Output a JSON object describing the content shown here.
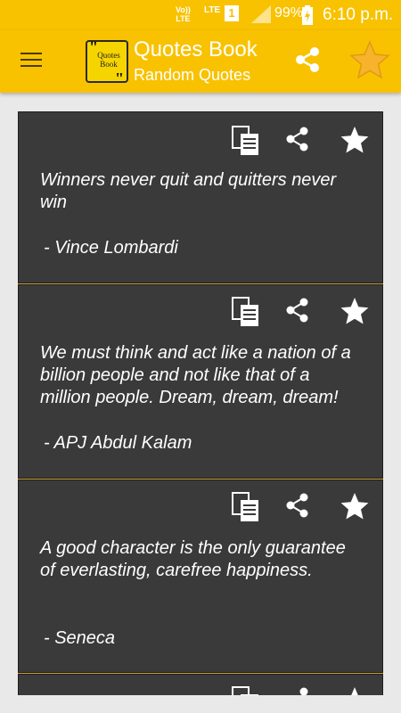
{
  "status_bar": {
    "volte": "Vo))\nLTE",
    "lte": "LTE",
    "sim": "1",
    "battery": "99%",
    "time": "6:10 p.m."
  },
  "app_bar": {
    "logo_text": "Quotes Book",
    "title": "Quotes Book",
    "subtitle": "Random Quotes"
  },
  "colors": {
    "accent": "#f8c200",
    "card_bg": "#3a3a3a",
    "separator": "#c8a23a"
  },
  "quotes": [
    {
      "text": "Winners never quit and quitters never win",
      "author": "- Vince Lombardi"
    },
    {
      "text": "We must think and act like a nation of a billion people and not like that of a million people. Dream, dream, dream!",
      "author": "- APJ Abdul Kalam"
    },
    {
      "text": "A good character is the only guarantee of everlasting, carefree happiness.",
      "author": "- Seneca"
    }
  ]
}
